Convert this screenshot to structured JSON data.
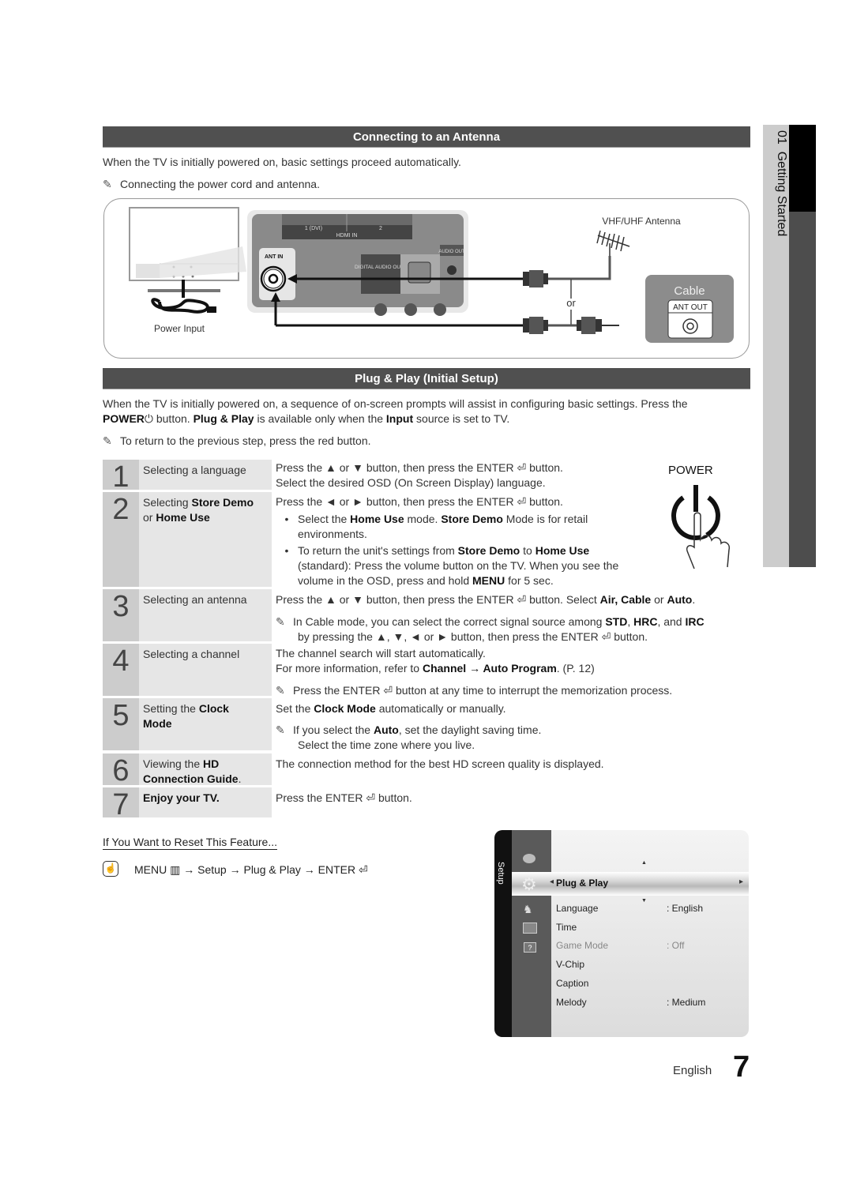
{
  "side_tab": {
    "chapter": "01",
    "title": "Getting Started"
  },
  "antenna_section": {
    "header": "Connecting to an Antenna",
    "intro": "When the TV is initially powered on, basic settings proceed automatically.",
    "note": "Connecting the power cord and antenna.",
    "diagram": {
      "power_label": "Power Input",
      "hdmi_port_1": "1 (DVI)",
      "hdmi_port_2": "2",
      "hdmi_label": "HDMI IN",
      "ant_in_label": "ANT IN",
      "digital_audio_label": "DIGITAL AUDIO OUT",
      "audio_out_label": "AUDIO OUT",
      "antenna_label": "VHF/UHF Antenna",
      "or_label": "or",
      "cable_label": "Cable",
      "ant_out_label": "ANT OUT"
    }
  },
  "plug_section": {
    "header": "Plug & Play (Initial Setup)",
    "intro_line1": "When the TV is initially powered on, a sequence of on-screen prompts will assist in configuring basic settings. Press the",
    "intro_line2_a": "POWER",
    "intro_line2_b": " button. ",
    "intro_line2_c": "Plug & Play",
    "intro_line2_d": " is available only when the ",
    "intro_line2_e": "Input",
    "intro_line2_f": " source is set to TV.",
    "note": "To return to the previous step, press the red button.",
    "power_label": "POWER",
    "steps": [
      {
        "num": "1",
        "title": "Selecting a language",
        "lines": [
          "Press the ▲ or ▼ button, then press the ENTER ⏎ button.",
          "Select the desired OSD (On Screen Display) language."
        ]
      },
      {
        "num": "2",
        "title_a": "Selecting ",
        "title_b": "Store Demo",
        "title_c": "or ",
        "title_d": "Home Use",
        "line1": "Press the ◄ or ► button, then press the ENTER ⏎ button.",
        "bullet1_a": "Select the ",
        "bullet1_b": "Home Use",
        "bullet1_c": " mode. ",
        "bullet1_d": "Store Demo",
        "bullet1_e": " Mode is for retail",
        "bullet1_f": "environments.",
        "bullet2_a": "To return the unit's settings from ",
        "bullet2_b": "Store Demo",
        "bullet2_c": " to ",
        "bullet2_d": "Home Use",
        "bullet2_e": "(standard): Press the volume button on the TV. When you see the",
        "bullet2_f": "volume in the OSD, press and hold ",
        "bullet2_g": "MENU",
        "bullet2_h": " for 5 sec."
      },
      {
        "num": "3",
        "title": "Selecting an antenna",
        "line1_a": "Press the ▲ or ▼ button, then press the ENTER ⏎ button. Select ",
        "line1_b": "Air, Cable",
        "line1_c": " or ",
        "line1_d": "Auto",
        "line1_e": ".",
        "note_a": "In Cable mode, you can select the correct signal source among ",
        "note_b": "STD",
        "note_c": ", ",
        "note_d": "HRC",
        "note_e": ", and ",
        "note_f": "IRC",
        "note_line2": "by pressing the ▲, ▼, ◄ or ► button, then press the ENTER ⏎ button."
      },
      {
        "num": "4",
        "title": "Selecting a channel",
        "line1": "The channel search will start automatically.",
        "line2_a": "For more information, refer to ",
        "line2_b": "Channel → Auto Program",
        "line2_c": ". (P. 12)",
        "note": "Press the ENTER ⏎ button at any time to interrupt the memorization process."
      },
      {
        "num": "5",
        "title_a": "Setting the ",
        "title_b": "Clock",
        "title_c": "Mode",
        "line1_a": "Set the ",
        "line1_b": "Clock Mode",
        "line1_c": " automatically or manually.",
        "note_a": "If you select the ",
        "note_b": "Auto",
        "note_c": ", set the daylight saving time.",
        "note_line2": "Select the time zone where you live."
      },
      {
        "num": "6",
        "title_a": "Viewing the ",
        "title_b": "HD",
        "title_c": "Connection Guide",
        "title_d": ".",
        "line1": "The connection method for the best HD screen quality is displayed."
      },
      {
        "num": "7",
        "title": "Enjoy your TV.",
        "line1": "Press the ENTER ⏎ button."
      }
    ]
  },
  "reset": {
    "heading": "If You Want to Reset This Feature...",
    "path": "MENU ▥ → Setup → Plug & Play → ENTER ⏎"
  },
  "osd_menu": {
    "side_label": "Setup",
    "highlighted": "Plug & Play",
    "items": [
      {
        "label": "Language",
        "value": ": English",
        "disabled": false
      },
      {
        "label": "Time",
        "value": "",
        "disabled": false
      },
      {
        "label": "Game Mode",
        "value": ": Off",
        "disabled": true
      },
      {
        "label": "V-Chip",
        "value": "",
        "disabled": false
      },
      {
        "label": "Caption",
        "value": "",
        "disabled": false
      },
      {
        "label": "Melody",
        "value": ": Medium",
        "disabled": false
      }
    ]
  },
  "footer": {
    "language": "English",
    "page_number": "7"
  }
}
